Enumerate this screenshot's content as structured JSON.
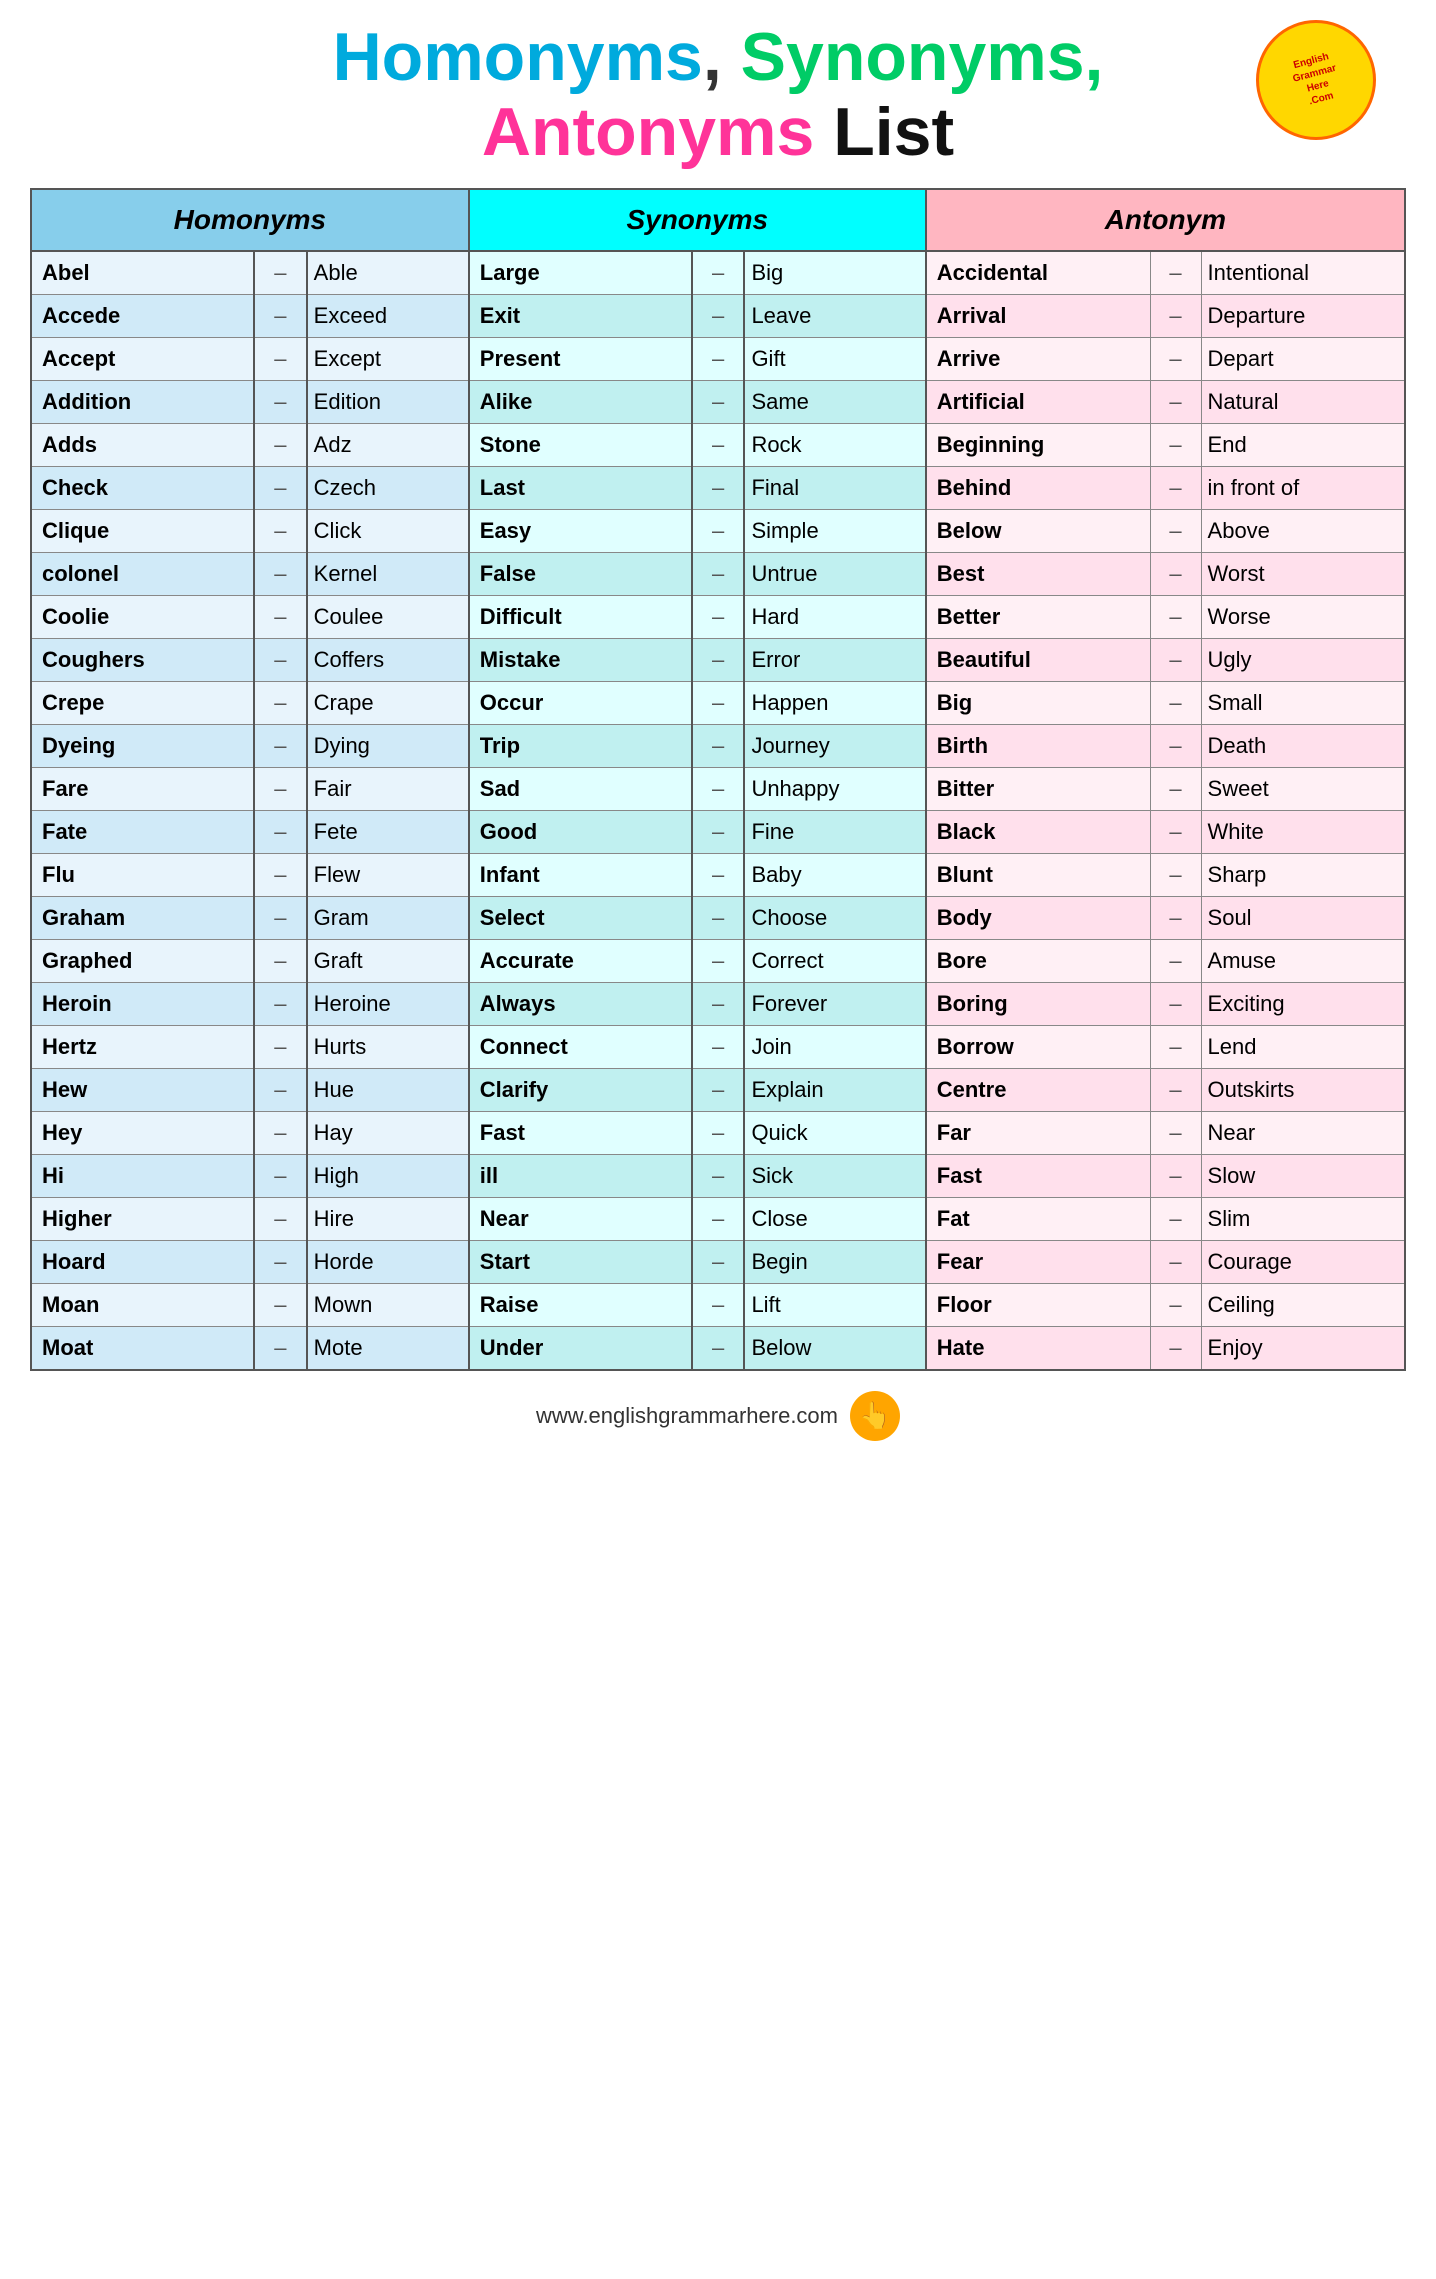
{
  "header": {
    "title_homonyms": "Homonyms",
    "title_synonyms": "Synonyms,",
    "title_antonyms": "Antonyms",
    "title_list": "List"
  },
  "columns": {
    "homonyms_header": "Homonyms",
    "synonyms_header": "Synonyms",
    "antonyms_header": "Antonym"
  },
  "homonyms": [
    {
      "word": "Abel",
      "pair": "Able"
    },
    {
      "word": "Accede",
      "pair": "Exceed"
    },
    {
      "word": "Accept",
      "pair": "Except"
    },
    {
      "word": "Addition",
      "pair": "Edition"
    },
    {
      "word": "Adds",
      "pair": "Adz"
    },
    {
      "word": "Check",
      "pair": "Czech"
    },
    {
      "word": "Clique",
      "pair": "Click"
    },
    {
      "word": "colonel",
      "pair": "Kernel"
    },
    {
      "word": "Coolie",
      "pair": "Coulee"
    },
    {
      "word": "Coughers",
      "pair": "Coffers"
    },
    {
      "word": "Crepe",
      "pair": "Crape"
    },
    {
      "word": "Dyeing",
      "pair": "Dying"
    },
    {
      "word": "Fare",
      "pair": "Fair"
    },
    {
      "word": "Fate",
      "pair": "Fete"
    },
    {
      "word": "Flu",
      "pair": "Flew"
    },
    {
      "word": "Graham",
      "pair": "Gram"
    },
    {
      "word": "Graphed",
      "pair": "Graft"
    },
    {
      "word": "Heroin",
      "pair": "Heroine"
    },
    {
      "word": "Hertz",
      "pair": "Hurts"
    },
    {
      "word": "Hew",
      "pair": "Hue"
    },
    {
      "word": "Hey",
      "pair": "Hay"
    },
    {
      "word": "Hi",
      "pair": "High"
    },
    {
      "word": "Higher",
      "pair": "Hire"
    },
    {
      "word": "Hoard",
      "pair": "Horde"
    },
    {
      "word": "Moan",
      "pair": "Mown"
    },
    {
      "word": "Moat",
      "pair": "Mote"
    }
  ],
  "synonyms": [
    {
      "word": "Large",
      "pair": "Big"
    },
    {
      "word": "Exit",
      "pair": "Leave"
    },
    {
      "word": "Present",
      "pair": "Gift"
    },
    {
      "word": "Alike",
      "pair": "Same"
    },
    {
      "word": "Stone",
      "pair": "Rock"
    },
    {
      "word": "Last",
      "pair": "Final"
    },
    {
      "word": "Easy",
      "pair": "Simple"
    },
    {
      "word": "False",
      "pair": "Untrue"
    },
    {
      "word": "Difficult",
      "pair": "Hard"
    },
    {
      "word": "Mistake",
      "pair": "Error"
    },
    {
      "word": "Occur",
      "pair": "Happen"
    },
    {
      "word": "Trip",
      "pair": "Journey"
    },
    {
      "word": "Sad",
      "pair": "Unhappy"
    },
    {
      "word": "Good",
      "pair": "Fine"
    },
    {
      "word": "Infant",
      "pair": "Baby"
    },
    {
      "word": "Select",
      "pair": "Choose"
    },
    {
      "word": "Accurate",
      "pair": "Correct"
    },
    {
      "word": "Always",
      "pair": "Forever"
    },
    {
      "word": "Connect",
      "pair": "Join"
    },
    {
      "word": "Clarify",
      "pair": "Explain"
    },
    {
      "word": "Fast",
      "pair": "Quick"
    },
    {
      "word": "ill",
      "pair": "Sick"
    },
    {
      "word": "Near",
      "pair": "Close"
    },
    {
      "word": "Start",
      "pair": "Begin"
    },
    {
      "word": "Raise",
      "pair": "Lift"
    },
    {
      "word": "Under",
      "pair": "Below"
    }
  ],
  "antonyms": [
    {
      "word": "Accidental",
      "pair": "Intentional"
    },
    {
      "word": "Arrival",
      "pair": "Departure"
    },
    {
      "word": "Arrive",
      "pair": "Depart"
    },
    {
      "word": "Artificial",
      "pair": "Natural"
    },
    {
      "word": "Beginning",
      "pair": "End"
    },
    {
      "word": "Behind",
      "pair": "in front of"
    },
    {
      "word": "Below",
      "pair": "Above"
    },
    {
      "word": "Best",
      "pair": "Worst"
    },
    {
      "word": "Better",
      "pair": "Worse"
    },
    {
      "word": "Beautiful",
      "pair": "Ugly"
    },
    {
      "word": "Big",
      "pair": "Small"
    },
    {
      "word": "Birth",
      "pair": "Death"
    },
    {
      "word": "Bitter",
      "pair": "Sweet"
    },
    {
      "word": "Black",
      "pair": "White"
    },
    {
      "word": "Blunt",
      "pair": "Sharp"
    },
    {
      "word": "Body",
      "pair": "Soul"
    },
    {
      "word": "Bore",
      "pair": "Amuse"
    },
    {
      "word": "Boring",
      "pair": "Exciting"
    },
    {
      "word": "Borrow",
      "pair": "Lend"
    },
    {
      "word": "Centre",
      "pair": "Outskirts"
    },
    {
      "word": "Far",
      "pair": "Near"
    },
    {
      "word": "Fast",
      "pair": "Slow"
    },
    {
      "word": "Fat",
      "pair": "Slim"
    },
    {
      "word": "Fear",
      "pair": "Courage"
    },
    {
      "word": "Floor",
      "pair": "Ceiling"
    },
    {
      "word": "Hate",
      "pair": "Enjoy"
    }
  ],
  "footer": {
    "website": "www.englishgrammarhere.com"
  }
}
